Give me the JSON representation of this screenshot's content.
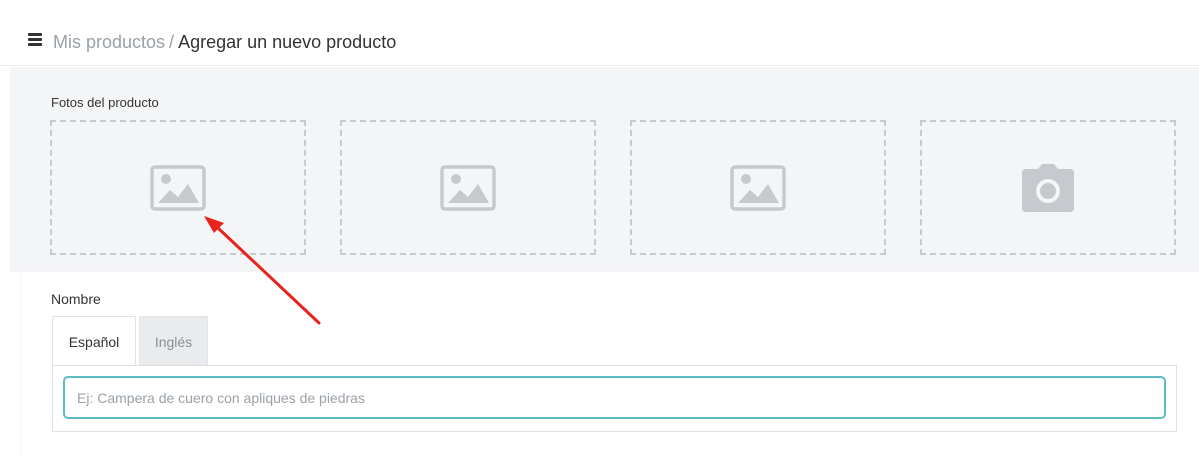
{
  "header": {
    "breadcrumb_link": "Mis productos",
    "breadcrumb_separator": "/",
    "breadcrumb_current": "Agregar un nuevo producto"
  },
  "photos": {
    "label": "Fotos del producto",
    "slots": [
      "image-icon",
      "image-icon",
      "image-icon",
      "camera-icon"
    ]
  },
  "name": {
    "label": "Nombre",
    "tabs": [
      {
        "label": "Español",
        "active": true
      },
      {
        "label": "Inglés",
        "active": false
      }
    ],
    "placeholder": "Ej: Campera de cuero con apliques de piedras",
    "value": ""
  },
  "colors": {
    "input_focus_border": "#5bbcc6",
    "annotation_arrow": "#e8231d",
    "photos_background": "#f4f5f6"
  }
}
